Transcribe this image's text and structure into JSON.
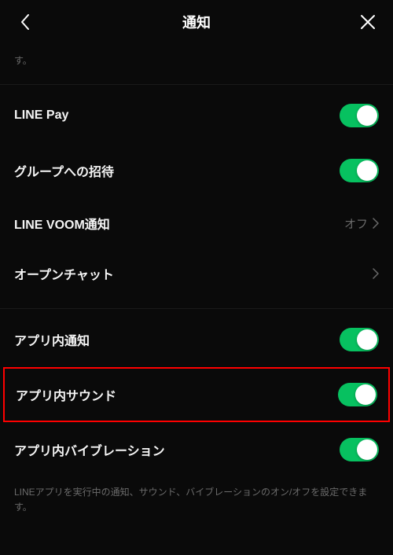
{
  "header": {
    "title": "通知"
  },
  "top_description_fragment": "す。",
  "section1": {
    "items": [
      {
        "label": "LINE Pay",
        "type": "toggle",
        "on": true
      },
      {
        "label": "グループへの招待",
        "type": "toggle",
        "on": true
      },
      {
        "label": "LINE VOOM通知",
        "type": "link",
        "value": "オフ"
      },
      {
        "label": "オープンチャット",
        "type": "link",
        "value": ""
      }
    ]
  },
  "section2": {
    "items": [
      {
        "label": "アプリ内通知",
        "type": "toggle",
        "on": true
      },
      {
        "label": "アプリ内サウンド",
        "type": "toggle",
        "on": true,
        "highlighted": true
      },
      {
        "label": "アプリ内バイブレーション",
        "type": "toggle",
        "on": true
      }
    ]
  },
  "footer_description": "LINEアプリを実行中の通知、サウンド、バイブレーションのオン/オフを設定できます。"
}
